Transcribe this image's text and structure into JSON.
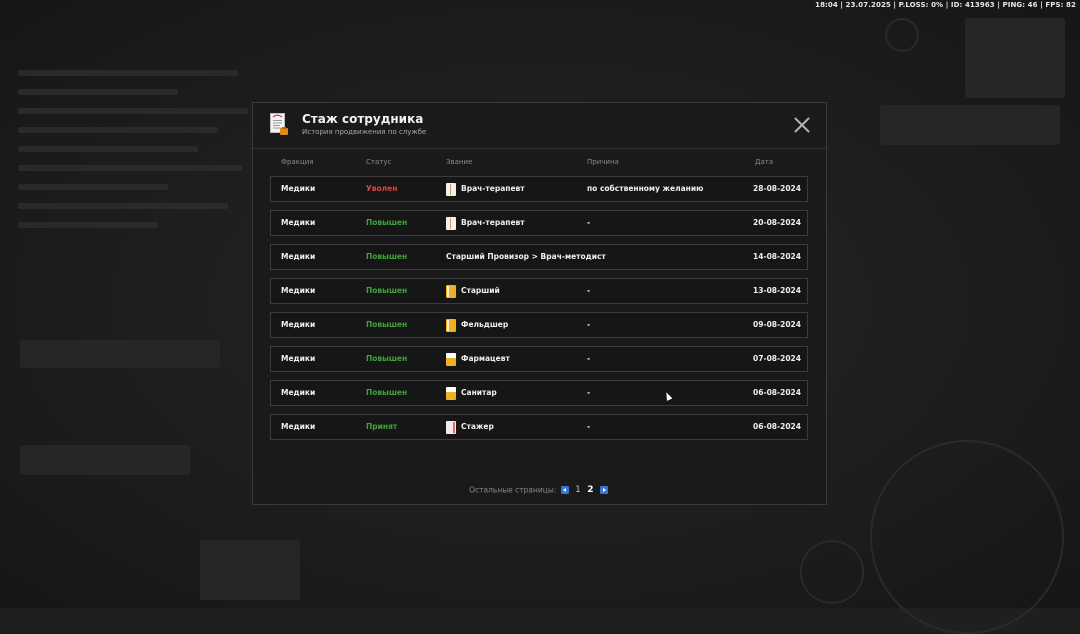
{
  "status_bar": {
    "text": "18:04 | 23.07.2025 | P.LOSS: 0% | ID: 413963 | PING: 46 | FPS: 82"
  },
  "modal": {
    "title": "Стаж сотрудника",
    "subtitle": "История продвижения по службе",
    "icon": "document-icon",
    "close_icon": "close-icon",
    "columns": {
      "fraction": "Фракция",
      "status": "Статус",
      "rank": "Звание",
      "reason": "Причина",
      "date": "Дата"
    },
    "rows": [
      {
        "fraction": "Медики",
        "status": "Уволен",
        "status_color": "#d04848",
        "rank": "Врач-терапевт",
        "rank_icon": "white",
        "reason": "по собственному желанию",
        "date": "28-08-2024"
      },
      {
        "fraction": "Медики",
        "status": "Повышен",
        "status_color": "#3fa43a",
        "rank": "Врач-терапевт",
        "rank_icon": "white",
        "reason": "-",
        "date": "20-08-2024"
      },
      {
        "fraction": "Медики",
        "status": "Повышен",
        "status_color": "#3fa43a",
        "rank": "Старший Провизор > Врач-методист",
        "rank_icon": "",
        "reason": "",
        "date": "14-08-2024"
      },
      {
        "fraction": "Медики",
        "status": "Повышен",
        "status_color": "#3fa43a",
        "rank": "Старший",
        "rank_icon": "yellow",
        "reason": "-",
        "date": "13-08-2024"
      },
      {
        "fraction": "Медики",
        "status": "Повышен",
        "status_color": "#3fa43a",
        "rank": "Фельдшер",
        "rank_icon": "yellow",
        "reason": "-",
        "date": "09-08-2024"
      },
      {
        "fraction": "Медики",
        "status": "Повышен",
        "status_color": "#3fa43a",
        "rank": "Фармацевт",
        "rank_icon": "half",
        "reason": "-",
        "date": "07-08-2024"
      },
      {
        "fraction": "Медики",
        "status": "Повышен",
        "status_color": "#3fa43a",
        "rank": "Санитар",
        "rank_icon": "half",
        "reason": "-",
        "date": "06-08-2024"
      },
      {
        "fraction": "Медики",
        "status": "Принят",
        "status_color": "#3fa43a",
        "rank": "Стажер",
        "rank_icon": "pink",
        "reason": "-",
        "date": "06-08-2024"
      }
    ],
    "pagination": {
      "label": "Остальные страницы:",
      "pages": [
        "1",
        "2"
      ],
      "current": "2"
    }
  }
}
